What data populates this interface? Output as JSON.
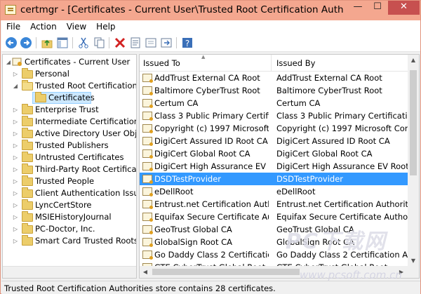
{
  "window": {
    "title": "certmgr - [Certificates - Current User\\Trusted Root Certification Authorities\\Cer...",
    "min_label": "—",
    "max_label": "☐",
    "close_label": "✕"
  },
  "menu": [
    "File",
    "Action",
    "View",
    "Help"
  ],
  "toolbar": {
    "icons": [
      "back-icon",
      "forward-icon",
      "up-folder-icon",
      "show-hide-tree-icon",
      "cut-icon",
      "copy-icon",
      "delete-icon",
      "properties-icon",
      "refresh-icon",
      "export-icon",
      "help-icon"
    ]
  },
  "tree": [
    {
      "label": "Certificates - Current User",
      "level": 0,
      "expanded": true
    },
    {
      "label": "Personal",
      "level": 1,
      "expanded": false
    },
    {
      "label": "Trusted Root Certification Au",
      "level": 1,
      "expanded": true
    },
    {
      "label": "Certificates",
      "level": 2,
      "selected": true
    },
    {
      "label": "Enterprise Trust",
      "level": 1,
      "expanded": false
    },
    {
      "label": "Intermediate Certification Au",
      "level": 1,
      "expanded": false
    },
    {
      "label": "Active Directory User Object",
      "level": 1,
      "expanded": false
    },
    {
      "label": "Trusted Publishers",
      "level": 1,
      "expanded": false
    },
    {
      "label": "Untrusted Certificates",
      "level": 1,
      "expanded": false
    },
    {
      "label": "Third-Party Root Certification",
      "level": 1,
      "expanded": false
    },
    {
      "label": "Trusted People",
      "level": 1,
      "expanded": false
    },
    {
      "label": "Client Authentication Issuers",
      "level": 1,
      "expanded": false
    },
    {
      "label": "LyncCertStore",
      "level": 1,
      "expanded": false
    },
    {
      "label": "MSIEHistoryJournal",
      "level": 1,
      "expanded": false
    },
    {
      "label": "PC-Doctor, Inc.",
      "level": 1,
      "expanded": false
    },
    {
      "label": "Smart Card Trusted Roots",
      "level": 1,
      "expanded": false
    }
  ],
  "list": {
    "columns": [
      "Issued To",
      "Issued By"
    ],
    "rows": [
      {
        "to": "AddTrust External CA Root",
        "by": "AddTrust External CA Root"
      },
      {
        "to": "Baltimore CyberTrust Root",
        "by": "Baltimore CyberTrust Root"
      },
      {
        "to": "Certum CA",
        "by": "Certum CA"
      },
      {
        "to": "Class 3 Public Primary Certificat...",
        "by": "Class 3 Public Primary Certificatio..."
      },
      {
        "to": "Copyright (c) 1997 Microsoft C...",
        "by": "Copyright (c) 1997 Microsoft Corp."
      },
      {
        "to": "DigiCert Assured ID Root CA",
        "by": "DigiCert Assured ID Root CA"
      },
      {
        "to": "DigiCert Global Root CA",
        "by": "DigiCert Global Root CA"
      },
      {
        "to": "DigiCert High Assurance EV Ro...",
        "by": "DigiCert High Assurance EV Root ..."
      },
      {
        "to": "DSDTestProvider",
        "by": "DSDTestProvider",
        "selected": true
      },
      {
        "to": "eDellRoot",
        "by": "eDellRoot"
      },
      {
        "to": "Entrust.net Certification Author...",
        "by": "Entrust.net Certification Authority..."
      },
      {
        "to": "Equifax Secure Certificate Auth...",
        "by": "Equifax Secure Certificate Authority"
      },
      {
        "to": "GeoTrust Global CA",
        "by": "GeoTrust Global CA"
      },
      {
        "to": "GlobalSign Root CA",
        "by": "GlobalSign Root CA"
      },
      {
        "to": "Go Daddy Class 2 Certification ...",
        "by": "Go Daddy Class 2 Certification Au..."
      },
      {
        "to": "GTE CyberTrust Global Root",
        "by": "GTE CyberTrust Global Root"
      }
    ]
  },
  "status": "Trusted Root Certification Authorities store contains 28 certificates.",
  "watermark": {
    "logo": "PC下载网",
    "url": "www.pcsoft.com.cn"
  }
}
